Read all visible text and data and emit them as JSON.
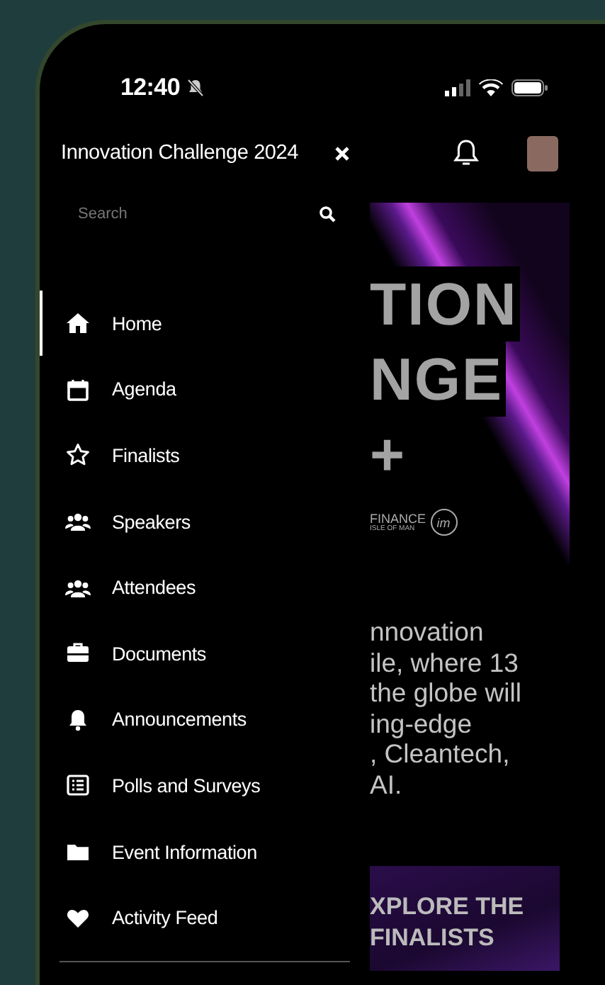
{
  "status_bar": {
    "time": "12:40"
  },
  "drawer": {
    "title": "Innovation Challenge 2024",
    "search": {
      "placeholder": "Search"
    },
    "items": [
      {
        "label": "Home",
        "selected": true
      },
      {
        "label": "Agenda",
        "selected": false
      },
      {
        "label": "Finalists",
        "selected": false
      },
      {
        "label": "Speakers",
        "selected": false
      },
      {
        "label": "Attendees",
        "selected": false
      },
      {
        "label": "Documents",
        "selected": false
      },
      {
        "label": "Announcements",
        "selected": false
      },
      {
        "label": "Polls and Surveys",
        "selected": false
      },
      {
        "label": "Event Information",
        "selected": false
      },
      {
        "label": "Activity Feed",
        "selected": false
      }
    ]
  },
  "hero": {
    "lines": [
      "TION",
      "NGE",
      "+"
    ],
    "logo": {
      "name": "FINANCE",
      "sub": "ISLE OF MAN",
      "mark": "im"
    }
  },
  "intro_lines": [
    "nnovation",
    "ile, where 13",
    "the globe will",
    "ing-edge",
    ", Cleantech,",
    "AI."
  ],
  "cta": {
    "lines": [
      "XPLORE THE",
      "FINALISTS"
    ]
  }
}
